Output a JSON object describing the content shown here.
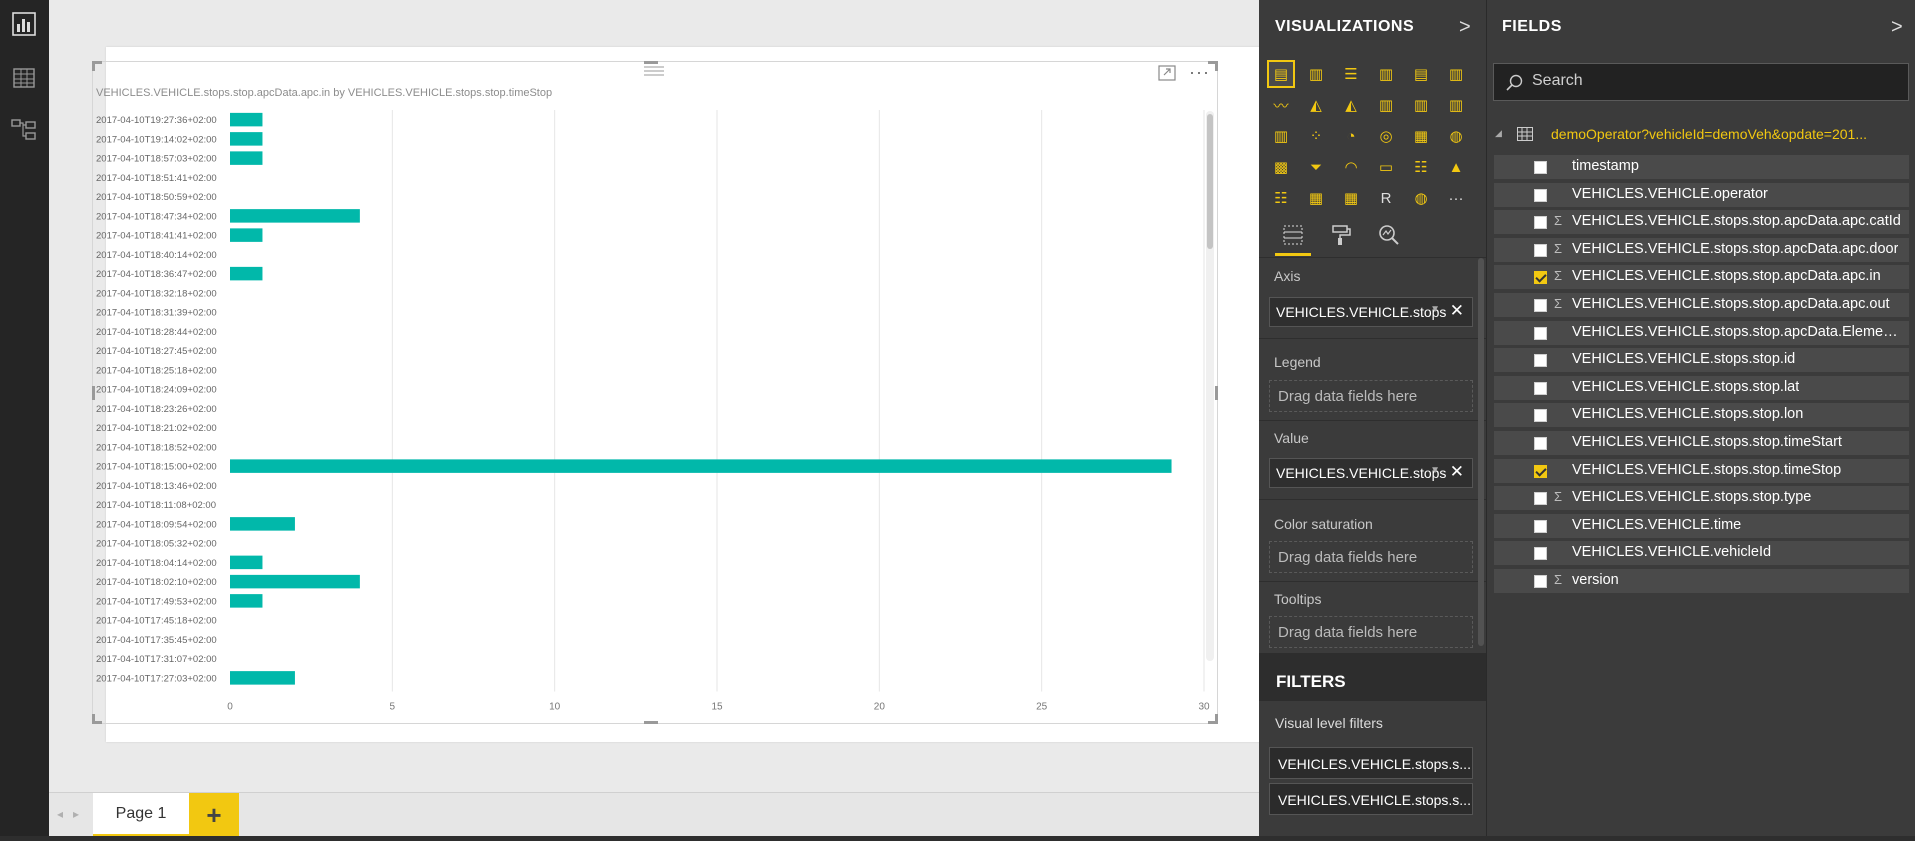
{
  "rail": {
    "items": [
      "report-view",
      "data-view",
      "relationships-view"
    ]
  },
  "visual": {
    "title": "VEHICLES.VEHICLE.stops.stop.apcData.apc.in by VEHICLES.VEHICLE.stops.stop.timeStop",
    "more": "···"
  },
  "chart_data": {
    "type": "bar",
    "orientation": "horizontal",
    "title": "VEHICLES.VEHICLE.stops.stop.apcData.apc.in by VEHICLES.VEHICLE.stops.stop.timeStop",
    "categories": [
      "2017-04-10T19:27:36+02:00",
      "2017-04-10T19:14:02+02:00",
      "2017-04-10T18:57:03+02:00",
      "2017-04-10T18:51:41+02:00",
      "2017-04-10T18:50:59+02:00",
      "2017-04-10T18:47:34+02:00",
      "2017-04-10T18:41:41+02:00",
      "2017-04-10T18:40:14+02:00",
      "2017-04-10T18:36:47+02:00",
      "2017-04-10T18:32:18+02:00",
      "2017-04-10T18:31:39+02:00",
      "2017-04-10T18:28:44+02:00",
      "2017-04-10T18:27:45+02:00",
      "2017-04-10T18:25:18+02:00",
      "2017-04-10T18:24:09+02:00",
      "2017-04-10T18:23:26+02:00",
      "2017-04-10T18:21:02+02:00",
      "2017-04-10T18:18:52+02:00",
      "2017-04-10T18:15:00+02:00",
      "2017-04-10T18:13:46+02:00",
      "2017-04-10T18:11:08+02:00",
      "2017-04-10T18:09:54+02:00",
      "2017-04-10T18:05:32+02:00",
      "2017-04-10T18:04:14+02:00",
      "2017-04-10T18:02:10+02:00",
      "2017-04-10T17:49:53+02:00",
      "2017-04-10T17:45:18+02:00",
      "2017-04-10T17:35:45+02:00",
      "2017-04-10T17:31:07+02:00",
      "2017-04-10T17:27:03+02:00"
    ],
    "values": [
      1,
      1,
      1,
      0,
      0,
      4,
      1,
      0,
      1,
      0,
      0,
      0,
      0,
      0,
      0,
      0,
      0,
      0,
      29,
      0,
      0,
      2,
      0,
      1,
      4,
      1,
      0,
      0,
      0,
      2
    ],
    "xlim": [
      0,
      30
    ],
    "xticks": [
      0,
      5,
      10,
      15,
      20,
      25,
      30
    ],
    "grid": "vertical",
    "bar_color": "#01b8aa"
  },
  "tabs": {
    "page_label": "Page 1",
    "add_label": "+",
    "prev": "◂",
    "next": "▸"
  },
  "viz_pane": {
    "title": "VISUALIZATIONS",
    "chevron": ">",
    "icons": [
      "stacked-bar",
      "stacked-column",
      "clustered-bar",
      "clustered-column",
      "100-bar",
      "100-column",
      "line",
      "area",
      "stacked-area",
      "line-column",
      "line-clustered",
      "ribbon",
      "waterfall",
      "scatter",
      "pie",
      "donut",
      "treemap",
      "map",
      "filled-map",
      "funnel",
      "gauge",
      "card",
      "multi-row-card",
      "kpi",
      "slicer",
      "table",
      "matrix",
      "r-visual",
      "globe",
      "more"
    ],
    "wells": {
      "axis_label": "Axis",
      "axis_field": "VEHICLES.VEHICLE.stops",
      "legend_label": "Legend",
      "legend_placeholder": "Drag data fields here",
      "value_label": "Value",
      "value_field": "VEHICLES.VEHICLE.stops",
      "color_label": "Color saturation",
      "color_placeholder": "Drag data fields here",
      "tooltips_label": "Tooltips",
      "tooltips_placeholder": "Drag data fields here"
    },
    "filters": {
      "title": "FILTERS",
      "sub": "Visual level filters",
      "items": [
        "VEHICLES.VEHICLE.stops.s...",
        "VEHICLES.VEHICLE.stops.s..."
      ]
    }
  },
  "fields_pane": {
    "title": "FIELDS",
    "chevron": ">",
    "search_placeholder": "Search",
    "table_name": "demoOperator?vehicleId=demoVeh&opdate=201...",
    "fields": [
      {
        "name": "timestamp",
        "sigma": false,
        "checked": false
      },
      {
        "name": "VEHICLES.VEHICLE.operator",
        "sigma": false,
        "checked": false
      },
      {
        "name": "VEHICLES.VEHICLE.stops.stop.apcData.apc.catId",
        "sigma": true,
        "checked": false
      },
      {
        "name": "VEHICLES.VEHICLE.stops.stop.apcData.apc.door",
        "sigma": true,
        "checked": false
      },
      {
        "name": "VEHICLES.VEHICLE.stops.stop.apcData.apc.in",
        "sigma": true,
        "checked": true
      },
      {
        "name": "VEHICLES.VEHICLE.stops.stop.apcData.apc.out",
        "sigma": true,
        "checked": false
      },
      {
        "name": "VEHICLES.VEHICLE.stops.stop.apcData.Elemen...",
        "sigma": false,
        "checked": false
      },
      {
        "name": "VEHICLES.VEHICLE.stops.stop.id",
        "sigma": false,
        "checked": false
      },
      {
        "name": "VEHICLES.VEHICLE.stops.stop.lat",
        "sigma": false,
        "checked": false
      },
      {
        "name": "VEHICLES.VEHICLE.stops.stop.lon",
        "sigma": false,
        "checked": false
      },
      {
        "name": "VEHICLES.VEHICLE.stops.stop.timeStart",
        "sigma": false,
        "checked": false
      },
      {
        "name": "VEHICLES.VEHICLE.stops.stop.timeStop",
        "sigma": false,
        "checked": true
      },
      {
        "name": "VEHICLES.VEHICLE.stops.stop.type",
        "sigma": true,
        "checked": false
      },
      {
        "name": "VEHICLES.VEHICLE.time",
        "sigma": false,
        "checked": false
      },
      {
        "name": "VEHICLES.VEHICLE.vehicleId",
        "sigma": false,
        "checked": false
      },
      {
        "name": "version",
        "sigma": true,
        "checked": false
      }
    ]
  },
  "colors": {
    "accent": "#f2c811",
    "bar": "#01b8aa",
    "pane": "#3b3b3b"
  }
}
